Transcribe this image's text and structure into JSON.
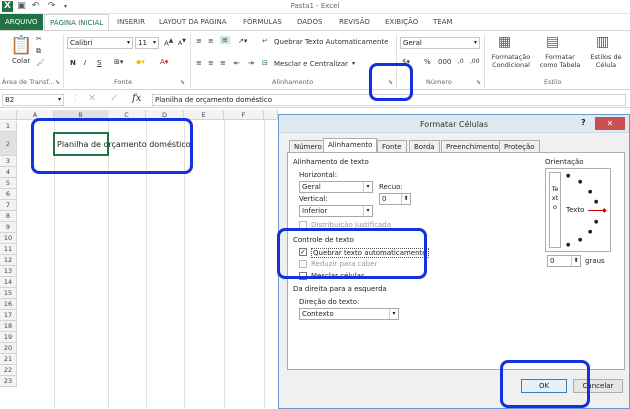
{
  "title": "Pasta1 - Excel",
  "tabs": [
    "ARQUIVO",
    "PÁGINA INICIAL",
    "INSERIR",
    "LAYOUT DA PÁGINA",
    "FÓRMULAS",
    "DADOS",
    "REVISÃO",
    "EXIBIÇÃO",
    "TEAM"
  ],
  "ribbon": {
    "paste": "Colar",
    "font_name": "Calibri",
    "font_size": "11",
    "bold": "N",
    "italic": "I",
    "underline": "S",
    "wrap_text": "Quebrar Texto Automaticamente",
    "merge_center": "Mesclar e Centralizar",
    "number_format": "Geral",
    "cond_format": "Formatação Condicional",
    "format_table": "Formatar como Tabela",
    "cell_styles": "Estilos de Célula",
    "groups": {
      "clipboard": "Área de Transf...",
      "font": "Fonte",
      "alignment": "Alinhamento",
      "number": "Número",
      "styles": "Estilo"
    }
  },
  "formula_bar": {
    "namebox": "B2",
    "fx": "fx",
    "content": "Planilha de orçamento doméstico"
  },
  "sheet": {
    "columns": [
      "A",
      "B",
      "C",
      "D",
      "E",
      "F"
    ],
    "rows": [
      "1",
      "2",
      "3",
      "4",
      "5",
      "6",
      "7",
      "8",
      "9",
      "10",
      "11",
      "12",
      "13",
      "14",
      "15",
      "16",
      "17",
      "18",
      "19",
      "20",
      "21",
      "22",
      "23"
    ],
    "cell_b2": "Planilha de orçamento doméstico"
  },
  "dialog": {
    "title": "Formatar Células",
    "help": "?",
    "close": "✕",
    "tabs": [
      "Número",
      "Alinhamento",
      "Fonte",
      "Borda",
      "Preenchimento",
      "Proteção"
    ],
    "section_alignment": "Alinhamento de texto",
    "horizontal_label": "Horizontal:",
    "horizontal_value": "Geral",
    "indent_label": "Recuo:",
    "indent_value": "0",
    "vertical_label": "Vertical:",
    "vertical_value": "Inferior",
    "distributed": "Distribuição justificada",
    "section_control": "Controle de texto",
    "wrap": "Quebrar texto automaticamente",
    "shrink": "Reduzir para caber",
    "merge": "Mesclar células",
    "section_rtl": "Da direita para a esquerda",
    "direction_label": "Direção do texto:",
    "direction_value": "Contexto",
    "orientation_label": "Orientação",
    "orientation_vertical": "Texto",
    "orientation_text": "Texto",
    "degrees_value": "0",
    "degrees_label": "graus",
    "ok": "OK",
    "cancel": "Cancelar"
  },
  "colors": {
    "accent": "#217346",
    "highlight": "#1431e0"
  }
}
